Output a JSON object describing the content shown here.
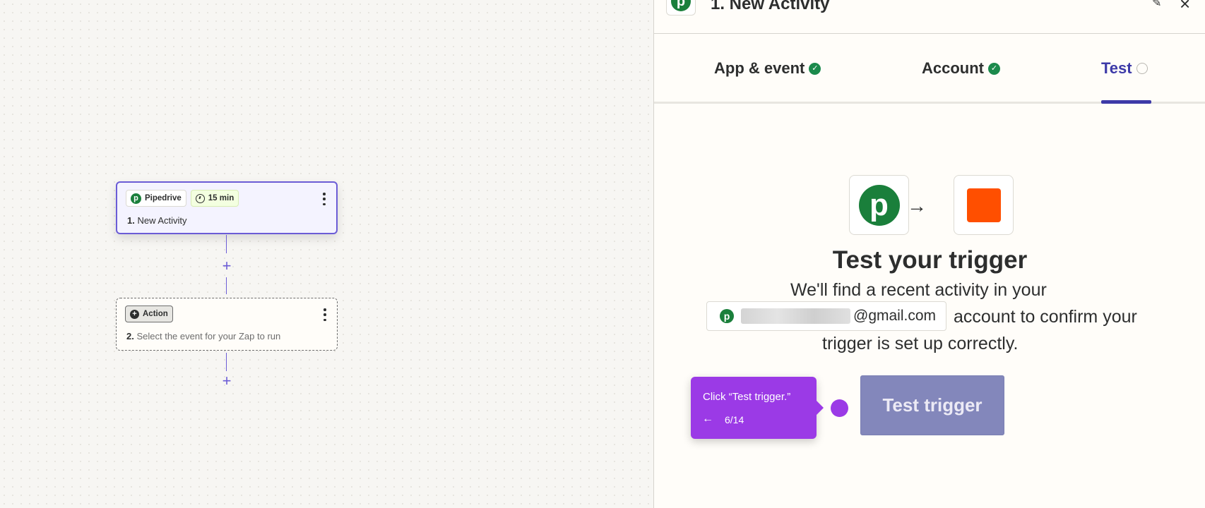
{
  "canvas": {
    "trigger_step": {
      "app_name": "Pipedrive",
      "app_logo_letter": "p",
      "interval": "15 min",
      "number": "1.",
      "title": "New Activity"
    },
    "action_step": {
      "chip_label": "Action",
      "number": "2.",
      "placeholder": "Select the event for your Zap to run"
    },
    "add_step_symbol": "+"
  },
  "panel": {
    "title": "1. New Activity",
    "tabs": [
      {
        "label": "App & event",
        "status": "complete"
      },
      {
        "label": "Account",
        "status": "complete"
      },
      {
        "label": "Test",
        "status": "pending"
      }
    ],
    "heading": "Test your trigger",
    "description_line1": "We'll find a recent activity in your",
    "account_email_suffix": "@gmail.com",
    "description_line2": "account to confirm your",
    "description_line3": "trigger is set up correctly.",
    "test_button_label": "Test trigger",
    "arrow_symbol": "→"
  },
  "guide": {
    "text": "Click “Test trigger.”",
    "back_symbol": "←",
    "progress": "6/14"
  },
  "colors": {
    "accent": "#3d3aa8",
    "pipedrive_green": "#1a7f3b",
    "zapier_orange": "#ff4f00",
    "guide_purple": "#9b3ae6",
    "check_green": "#1b8a4c"
  }
}
